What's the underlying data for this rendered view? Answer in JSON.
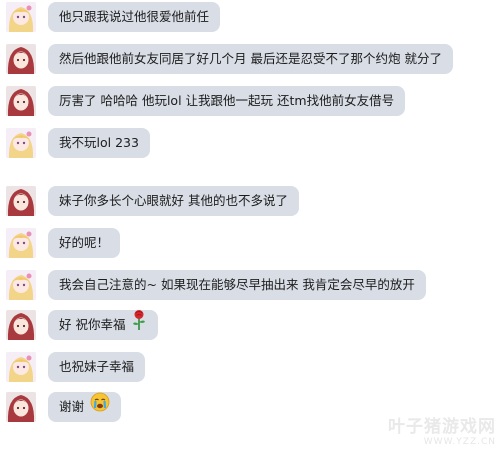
{
  "messages": [
    {
      "avatar": "blonde",
      "text": "他只跟我说过他很爱他前任"
    },
    {
      "avatar": "girl",
      "text": "然后他跟他前女友同居了好几个月 最后还是忍受不了那个约炮 就分了"
    },
    {
      "avatar": "girl",
      "text": "厉害了 哈哈哈  他玩lol  让我跟他一起玩 还tm找他前女友借号"
    },
    {
      "avatar": "blonde",
      "text": "我不玩lol 233"
    },
    {
      "avatar": "girl",
      "text": "妹子你多长个心眼就好 其他的也不多说了"
    },
    {
      "avatar": "blonde",
      "text": "好的呢！"
    },
    {
      "avatar": "blonde",
      "text": "我会自己注意的~ 如果现在能够尽早抽出来 我肯定会尽早的放开"
    },
    {
      "avatar": "girl",
      "text": "好 祝你幸福",
      "emoji": "rose-icon"
    },
    {
      "avatar": "blonde",
      "text": "也祝妹子幸福"
    },
    {
      "avatar": "girl",
      "text": "谢谢",
      "emoji": "crying-face-icon"
    }
  ],
  "watermark": {
    "main": "叶子猪游戏网",
    "sub": "WWW.YZZ.CN"
  },
  "colors": {
    "bubble": "#d8dde6",
    "background": "#ffffff"
  }
}
